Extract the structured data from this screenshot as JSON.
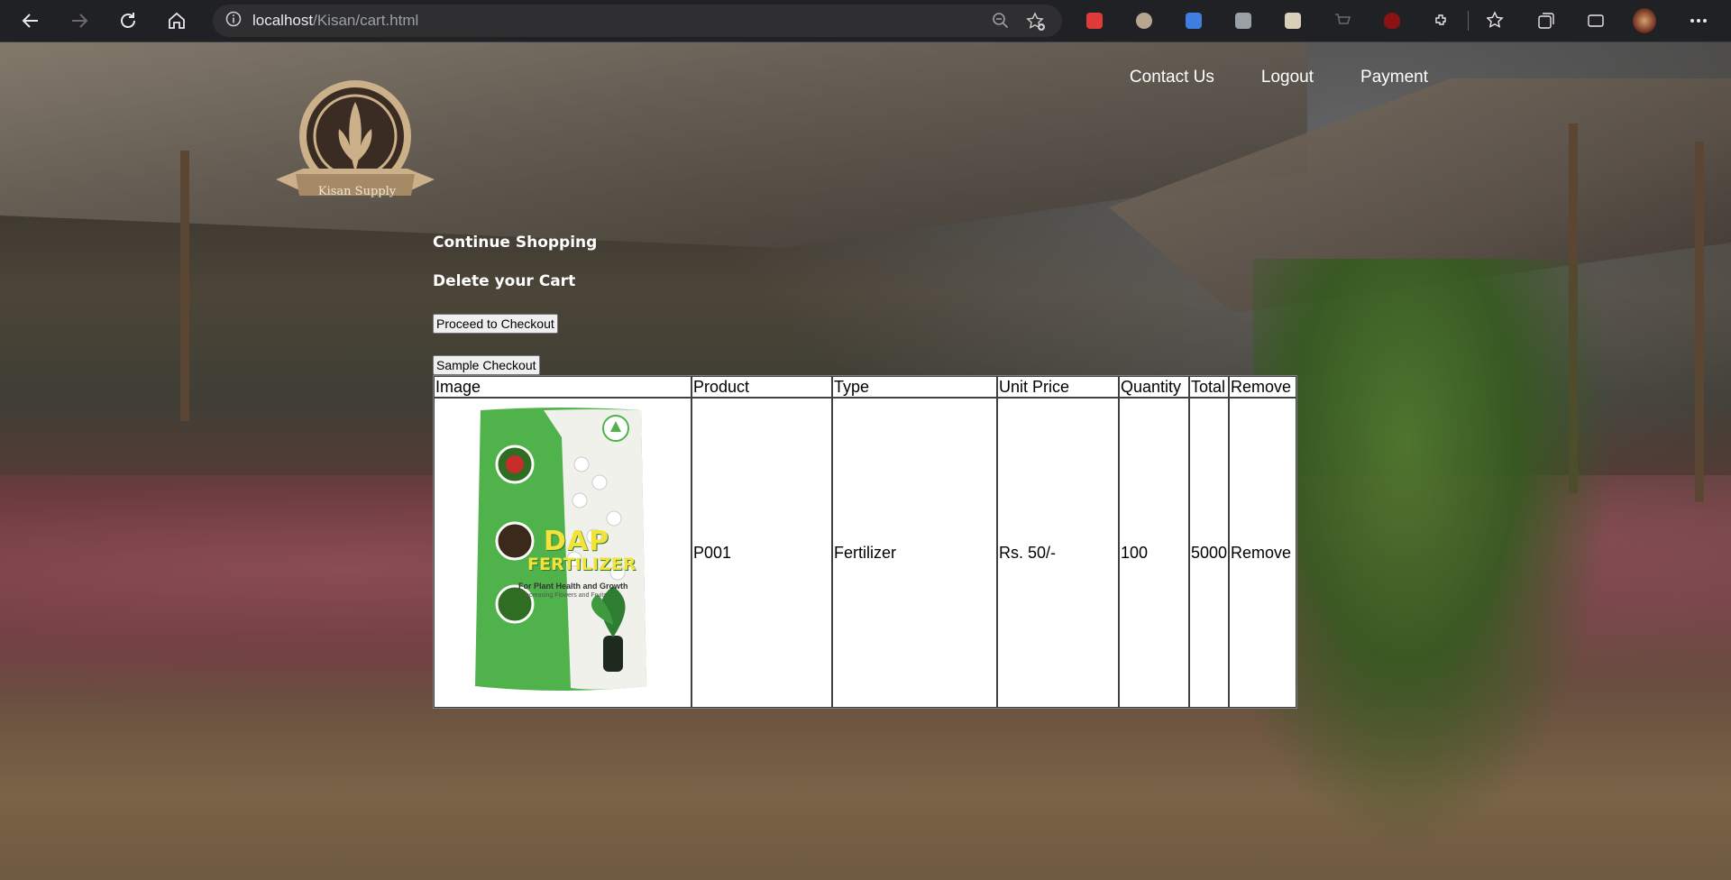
{
  "browser": {
    "url_host": "localhost",
    "url_path": "/Kisan/cart.html"
  },
  "site": {
    "logo_text": "Kisan Supply",
    "nav": [
      "Contact Us",
      "Logout",
      "Payment"
    ]
  },
  "cart": {
    "continue_label": "Continue Shopping",
    "delete_label": "Delete your Cart",
    "checkout_label": "Proceed to Checkout",
    "sample_checkout_label": "Sample Checkout",
    "columns": [
      "Image",
      "Product",
      "Type",
      "Unit Price",
      "Quantity",
      "Total",
      "Remove"
    ],
    "rows": [
      {
        "image_brand": "DAP",
        "image_name": "FERTILIZER",
        "image_tagline": "For Plant Health and Growth",
        "image_subline": "Increasing Flowers and Fruits",
        "product": "P001",
        "type": "Fertilizer",
        "unit_price": "Rs. 50/-",
        "quantity": "100",
        "total": "5000",
        "remove": "Remove"
      }
    ]
  },
  "colors": {
    "chrome_bg": "#202124",
    "pack_green": "#3aa43a",
    "pack_yellow": "#f3e23a"
  }
}
